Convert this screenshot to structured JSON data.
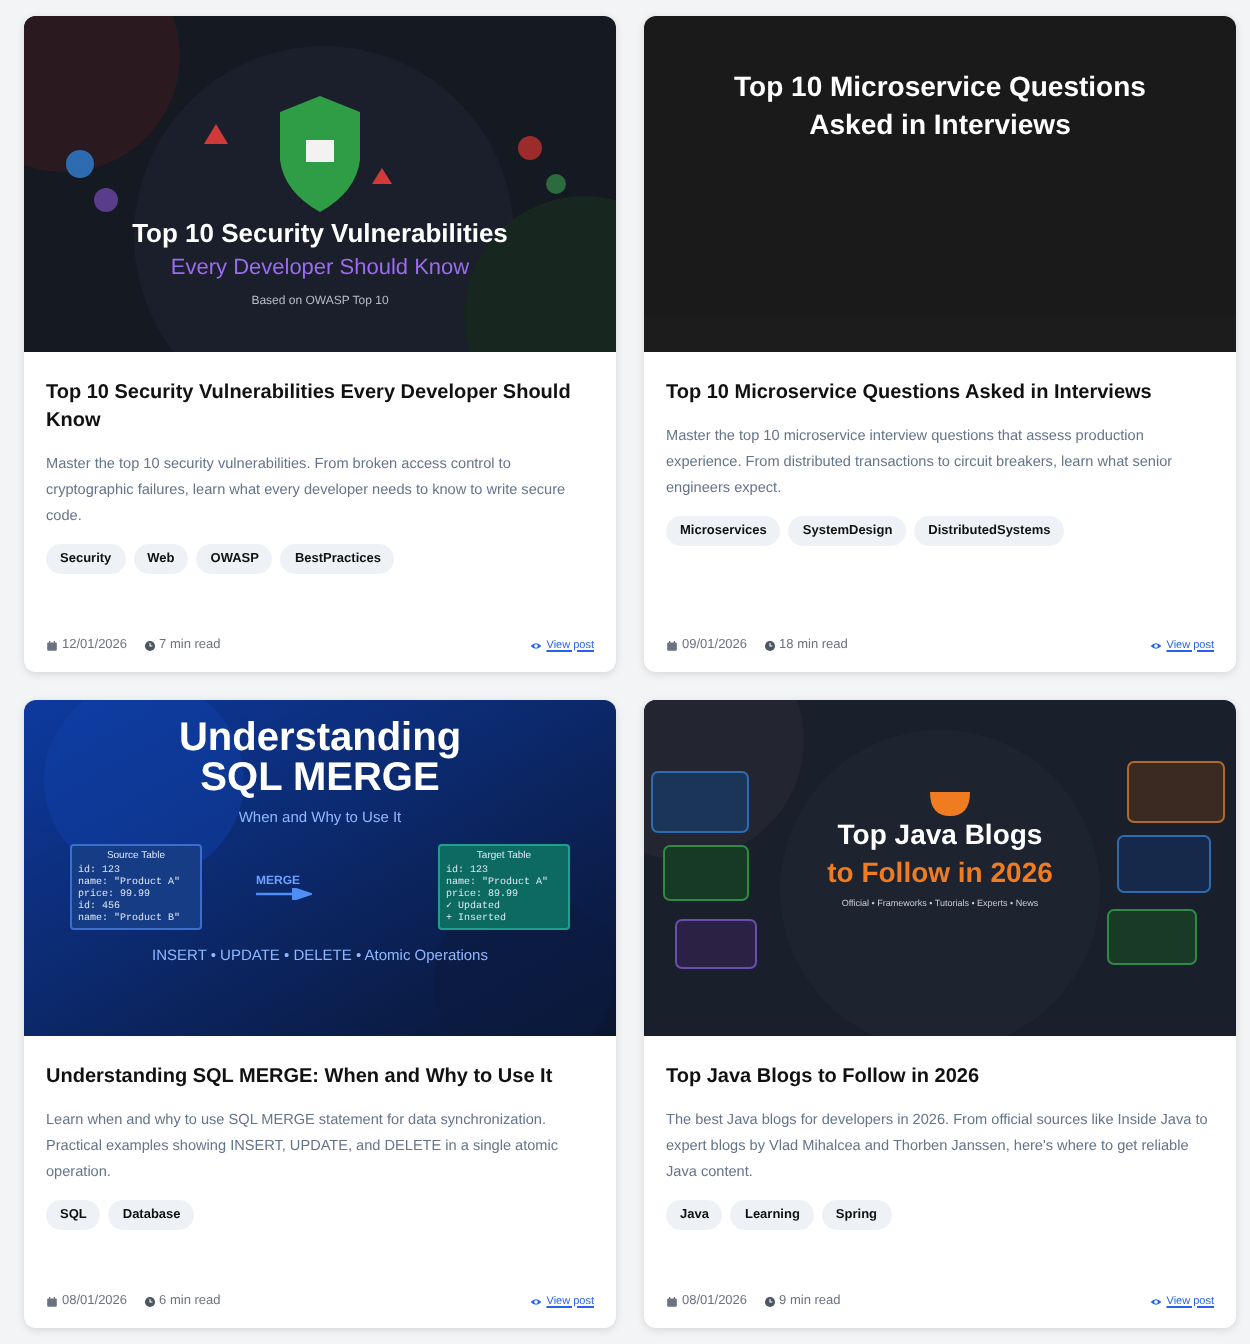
{
  "posts": [
    {
      "cover": {
        "kind": "security",
        "lines": [
          {
            "kind": "title",
            "text": "Top 10 Security Vulnerabilities"
          },
          {
            "kind": "subtitle",
            "text": "Every Developer Should Know"
          },
          {
            "kind": "note",
            "text": "Based on OWASP Top 10"
          }
        ]
      },
      "title": "Top 10 Security Vulnerabilities Every Developer Should Know",
      "description": "Master the top 10 security vulnerabilities. From broken access control to cryptographic failures, learn what every developer needs to know to write secure code.",
      "tags": [
        "Security",
        "Web",
        "OWASP",
        "BestPractices"
      ],
      "date": "12/01/2026",
      "read_time": "7 min read",
      "link": "View post"
    },
    {
      "cover": {
        "kind": "plain",
        "lines": [
          {
            "kind": "title",
            "text": "Top 10 Microservice Questions Asked in Interviews"
          }
        ]
      },
      "title": "Top 10 Microservice Questions Asked in Interviews",
      "description": "Master the top 10 microservice interview questions that assess production experience. From distributed transactions to circuit breakers, learn what senior engineers expect.",
      "tags": [
        "Microservices",
        "SystemDesign",
        "DistributedSystems"
      ],
      "date": "09/01/2026",
      "read_time": "18 min read",
      "link": "View post"
    },
    {
      "cover": {
        "kind": "sql",
        "lines": [
          {
            "kind": "title",
            "text": "Understanding SQL MERGE"
          },
          {
            "kind": "subtitle",
            "text": "When and Why to Use It"
          },
          {
            "kind": "diagram"
          },
          {
            "kind": "note",
            "text": "INSERT • UPDATE • DELETE • Atomic Operations"
          }
        ],
        "tables": [
          {
            "header": "Source Table",
            "lines": [
              "id: 123",
              "name: \"Product A\"",
              "price: 99.99",
              "id: 456",
              "name: \"Product B\""
            ]
          },
          {
            "header": "Target Table",
            "lines": [
              "id: 123",
              "name: \"Product A\"",
              "price: 89.99",
              "✓ Updated",
              "+ Inserted"
            ]
          }
        ],
        "connector": "MERGE"
      },
      "title": "Understanding SQL MERGE: When and Why to Use It",
      "description": "Learn when and why to use SQL MERGE statement for data synchronization. Practical examples showing INSERT, UPDATE, and DELETE in a single atomic operation.",
      "tags": [
        "SQL",
        "Database"
      ],
      "date": "08/01/2026",
      "read_time": "6 min read",
      "link": "View post"
    },
    {
      "cover": {
        "kind": "java",
        "lines": [
          {
            "kind": "title",
            "text": "Top Java Blogs"
          },
          {
            "kind": "subtitle",
            "text": "to Follow in 2026"
          },
          {
            "kind": "note",
            "text": "Official • Frameworks • Tutorials • Experts • News"
          }
        ]
      },
      "title": "Top Java Blogs to Follow in 2026",
      "description": "The best Java blogs for developers in 2026. From official sources like Inside Java to expert blogs by Vlad Mihalcea and Thorben Janssen, here's where to get reliable Java content.",
      "tags": [
        "Java",
        "Learning",
        "Spring"
      ],
      "date": "08/01/2026",
      "read_time": "9 min read",
      "link": "View post"
    }
  ]
}
